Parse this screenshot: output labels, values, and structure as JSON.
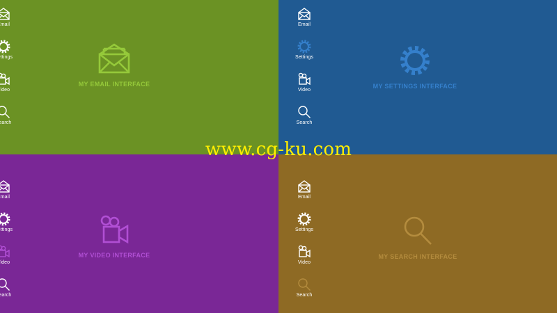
{
  "colors": {
    "email_bg": "#6b9224",
    "settings_bg": "#205a92",
    "video_bg": "#7a2796",
    "search_bg": "#8e6a24",
    "email_accent": "#95c93a",
    "settings_accent": "#3580cc",
    "video_accent": "#b14fd4",
    "search_accent": "#b48c3e",
    "watermark": "#ffee00"
  },
  "nav_items": [
    {
      "label": "Email",
      "icon": "envelope-icon"
    },
    {
      "label": "Settings",
      "icon": "gear-icon"
    },
    {
      "label": "Video",
      "icon": "video-camera-icon"
    },
    {
      "label": "Search",
      "icon": "magnifier-icon"
    }
  ],
  "panels": {
    "email": {
      "title": "MY EMAIL INTERFACE",
      "active_nav": "Email"
    },
    "settings": {
      "title": "MY SETTINGS INTERFACE",
      "active_nav": "Settings"
    },
    "video": {
      "title": "MY VIDEO INTERFACE",
      "active_nav": "Video"
    },
    "search": {
      "title": "MY SEARCH INTERFACE",
      "active_nav": "Search"
    }
  },
  "watermark": "www.cg-ku.com"
}
